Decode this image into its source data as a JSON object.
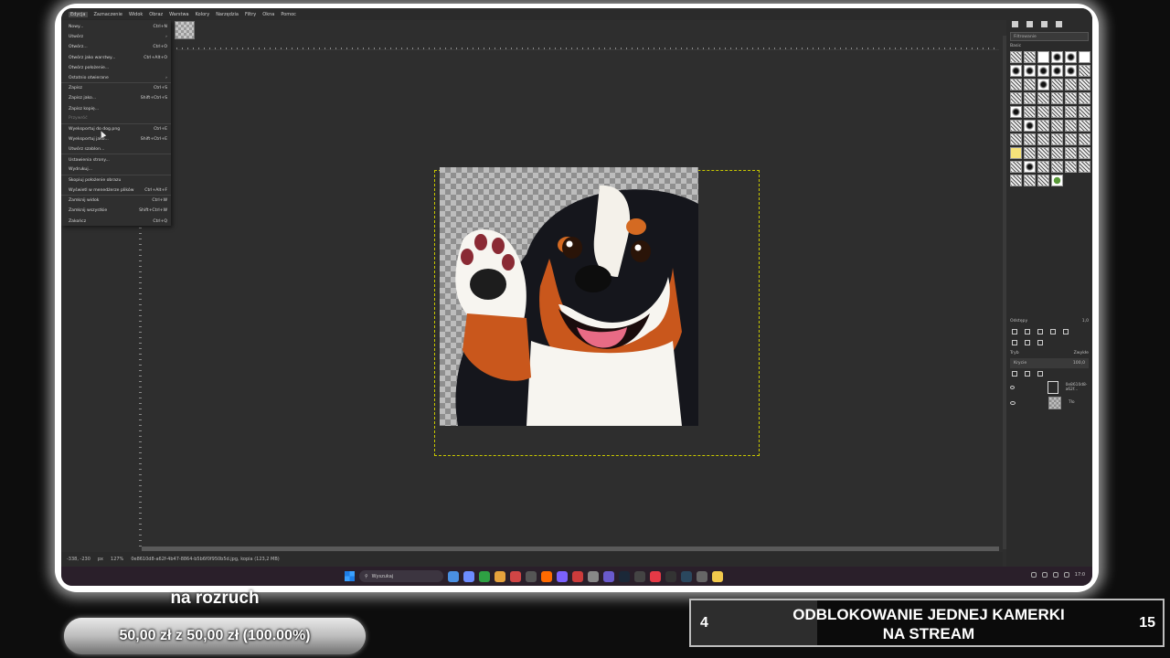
{
  "menubar": [
    "Edycja",
    "Zaznaczenie",
    "Widok",
    "Obraz",
    "Warstwa",
    "Kolory",
    "Narzędzia",
    "Filtry",
    "Okna",
    "Pomoc"
  ],
  "file_menu": [
    {
      "label": "Nowy...",
      "shortcut": "Ctrl+N"
    },
    {
      "label": "Utwórz",
      "shortcut": "›"
    },
    {
      "label": "Otwórz...",
      "shortcut": "Ctrl+O"
    },
    {
      "label": "Otwórz jako warstwy...",
      "shortcut": "Ctrl+Alt+O"
    },
    {
      "label": "Otwórz położenie...",
      "shortcut": ""
    },
    {
      "label": "Ostatnio otwierane",
      "shortcut": "›"
    },
    {
      "label": "Zapisz",
      "shortcut": "Ctrl+S"
    },
    {
      "label": "Zapisz jako...",
      "shortcut": "Shift+Ctrl+S"
    },
    {
      "label": "Zapisz kopię...",
      "shortcut": ""
    },
    {
      "label": "Przywróć",
      "shortcut": "",
      "disabled": true
    },
    {
      "label": "Wyeksportuj do dog.png",
      "shortcut": "Ctrl+E"
    },
    {
      "label": "Wyeksportuj jako...",
      "shortcut": "Shift+Ctrl+E"
    },
    {
      "label": "Utwórz szablon...",
      "shortcut": ""
    },
    {
      "label": "Ustawienia strony...",
      "shortcut": ""
    },
    {
      "label": "Wydrukuj...",
      "shortcut": ""
    },
    {
      "label": "Skopiuj położenie obrazu",
      "shortcut": ""
    },
    {
      "label": "Wyświetl w menedżerze plików",
      "shortcut": "Ctrl+Alt+F"
    },
    {
      "label": "Zamknij widok",
      "shortcut": "Ctrl+W"
    },
    {
      "label": "Zamknij wszystkie",
      "shortcut": "Shift+Ctrl+W"
    },
    {
      "label": "Zakończ",
      "shortcut": "Ctrl+Q"
    }
  ],
  "status": {
    "coords": "-338, -230",
    "unit": "px",
    "zoom": "127%",
    "filename": "0e8610d8-a62f-4b47-8864-b5b6f0f950b5d.jpg, kopia (123,2 MB)"
  },
  "right_panel": {
    "filter_placeholder": "Filtrowanie",
    "brushes_label": "Basic",
    "spacing_label": "Odstępy",
    "spacing_value": "1,0",
    "mode_label": "Tryb",
    "mode_value": "Zwykłe",
    "opacity_label": "Krycie",
    "opacity_value": "100,0",
    "layers": [
      {
        "name": "0e8610d8-a62f..."
      },
      {
        "name": "Tło"
      }
    ]
  },
  "taskbar": {
    "search": "Wyszukaj",
    "clock": "17:0"
  },
  "goal": {
    "title": "na rozruch",
    "progress_text": "50,00 zł z 50,00 zł (100.00%)",
    "progress": 1.0
  },
  "reward": {
    "count": "4",
    "goal": "15",
    "text_line1": "ODBLOKOWANIE JEDNEJ KAMERKI",
    "text_line2": "NA STREAM",
    "progress": 0.2667
  },
  "colors": {
    "accent": "#c8c800",
    "panel": "#2b2b2b",
    "canvas": "#2e2e2e"
  }
}
